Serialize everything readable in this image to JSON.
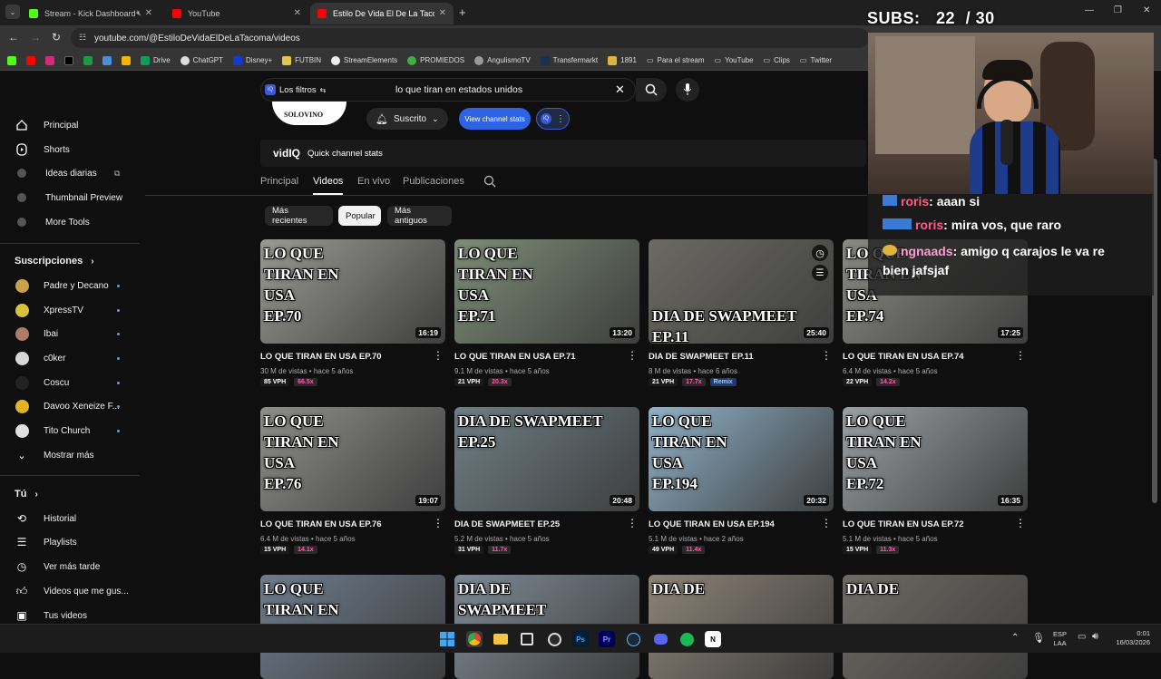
{
  "browser": {
    "tabs": [
      {
        "label": "Stream - Kick Dashboard",
        "color": "#53fc18"
      },
      {
        "label": "YouTube",
        "color": "#ff0000"
      },
      {
        "label": "Estilo De Vida El De La Tacoma",
        "color": "#ff0000"
      }
    ],
    "url": "youtube.com/@EstiloDeVidaElDeLaTacoma/videos",
    "bookmarks": [
      "Drive",
      "ChatGPT",
      "Disney+",
      "FUTBIN",
      "StreamElements",
      "PROMIEDOS",
      "AngulismoTV",
      "Transfermarkt",
      "1891",
      "Para el stream",
      "YouTube",
      "Clips",
      "Twitter"
    ]
  },
  "sidebar": {
    "top": [
      {
        "label": "Principal",
        "icon": "home-icon"
      },
      {
        "label": "Shorts",
        "icon": "shorts-icon"
      },
      {
        "label": "Ideas diarias",
        "icon": "vidiq-icon"
      },
      {
        "label": "Thumbnail Preview",
        "icon": "vidiq-icon"
      },
      {
        "label": "More Tools",
        "icon": "vidiq-icon"
      }
    ],
    "subs_title": "Suscripciones",
    "subs": [
      {
        "label": "Padre y Decano",
        "color": "#caa24a"
      },
      {
        "label": "XpressTV",
        "color": "#d8c23a"
      },
      {
        "label": "Ibai",
        "color": "#b07a6a"
      },
      {
        "label": "c0ker",
        "color": "#d8d8d8"
      },
      {
        "label": "Coscu",
        "color": "#222"
      },
      {
        "label": "Davoo Xeneize F...",
        "color": "#e6b422"
      },
      {
        "label": "Tito Church",
        "color": "#e0e0e0"
      }
    ],
    "show_more": "Mostrar más",
    "you_title": "Tú",
    "you": [
      {
        "label": "Historial",
        "icon": "history-icon"
      },
      {
        "label": "Playlists",
        "icon": "playlists-icon"
      },
      {
        "label": "Ver más tarde",
        "icon": "watch-later-icon"
      },
      {
        "label": "Videos que me gus...",
        "icon": "like-icon"
      },
      {
        "label": "Tus videos",
        "icon": "your-videos-icon"
      }
    ]
  },
  "search": {
    "filters_label": "Los filtros",
    "query": "lo que tiran en estados unidos"
  },
  "channel": {
    "banner_text": "SOLOVINO",
    "subscribe_label": "Suscrito",
    "stats_button": "View channel stats",
    "vidiq_logo": "vidIQ",
    "quick_stats": "Quick channel stats"
  },
  "channel_tabs": [
    "Principal",
    "Videos",
    "En vivo",
    "Publicaciones"
  ],
  "sort_chips": [
    "Más recientes",
    "Popular",
    "Más antiguos"
  ],
  "videos": [
    {
      "thumb_text": "LO QUE\nTIRAN EN\nUSA\nEP.70",
      "duration": "16:19",
      "title": "LO QUE TIRAN EN USA EP.70",
      "meta": "30 M de vistas • hace 5 años",
      "vph": "85 VPH",
      "mult": "66.5x",
      "bg": "#9a9a94"
    },
    {
      "thumb_text": "LO QUE\nTIRAN EN\nUSA\nEP.71",
      "duration": "13:20",
      "title": "LO QUE TIRAN EN USA EP.71",
      "meta": "9.1 M de vistas • hace 5 años",
      "vph": "21 VPH",
      "mult": "20.3x",
      "bg": "#7d8d76"
    },
    {
      "thumb_text": "\n\n\nDIA DE SWAPMEET EP.11",
      "duration": "25:40",
      "title": "DIA DE SWAPMEET EP.11",
      "meta": "8 M de vistas • hace 6 años",
      "vph": "21 VPH",
      "mult": "17.7x",
      "remix": "Remix",
      "bg": "#6b6a64"
    },
    {
      "thumb_text": "LO QUE\nTIRAN EN\nUSA\nEP.74",
      "duration": "17:25",
      "title": "LO QUE TIRAN EN USA EP.74",
      "meta": "6.4 M de vistas • hace 5 años",
      "vph": "22 VPH",
      "mult": "14.2x",
      "bg": "#8a8a86"
    },
    {
      "thumb_text": "LO QUE\nTIRAN EN\nUSA\nEP.76",
      "duration": "19:07",
      "title": "LO QUE TIRAN EN USA EP.76",
      "meta": "6.4 M de vistas • hace 5 años",
      "vph": "15 VPH",
      "mult": "14.1x",
      "bg": "#8e8e8c"
    },
    {
      "thumb_text": "DIA DE SWAPMEET EP.25",
      "duration": "20:48",
      "title": "DIA DE SWAPMEET EP.25",
      "meta": "5.2 M de vistas • hace 5 años",
      "vph": "31 VPH",
      "mult": "11.7x",
      "bg": "#6f7f86"
    },
    {
      "thumb_text": "LO QUE\nTIRAN EN\nUSA\nEP.194",
      "duration": "20:32",
      "title": "LO QUE TIRAN EN USA EP.194",
      "meta": "5.1 M de vistas • hace 2 años",
      "vph": "49 VPH",
      "mult": "11.4x",
      "bg": "#8fb2c9"
    },
    {
      "thumb_text": "LO QUE\nTIRAN EN\nUSA\nEP.72",
      "duration": "16:35",
      "title": "LO QUE TIRAN EN USA EP.72",
      "meta": "5.1 M de vistas • hace 5 años",
      "vph": "15 VPH",
      "mult": "11.3x",
      "bg": "#9aa0a4"
    },
    {
      "thumb_text": "LO QUE\nTIRAN EN",
      "bg": "#6d7c8e"
    },
    {
      "thumb_text": "DIA DE\nSWAPMEET",
      "bg": "#7e8a96"
    },
    {
      "thumb_text": "DIA DE",
      "bg": "#8d8376"
    },
    {
      "thumb_text": "DIA DE",
      "bg": "#6f6a64"
    }
  ],
  "overlay": {
    "subs_label": "SUBS:",
    "subs_count": "22",
    "subs_goal": "/ 30",
    "chat": [
      {
        "user": "roris",
        "sep": ": ",
        "text": "aaan si"
      },
      {
        "user": "roris",
        "sep": ": ",
        "text": "mira vos, que raro"
      },
      {
        "user": "ngnaads",
        "sep": ": ",
        "text": "amigo q carajos le va re"
      },
      {
        "user": "",
        "sep": "",
        "text": "bien jafsjaf"
      }
    ]
  },
  "taskbar": {
    "lang": "ESP",
    "region": "LAA",
    "time": "0:01",
    "date": "16/03/2026"
  }
}
